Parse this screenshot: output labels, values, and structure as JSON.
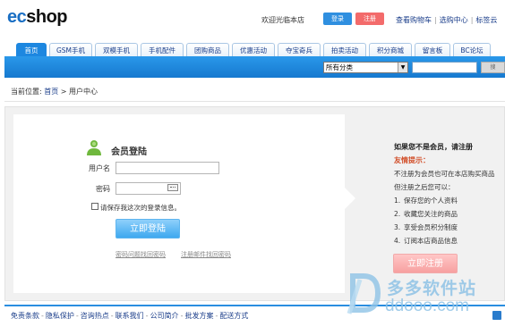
{
  "header": {
    "logo_part1": "ec",
    "logo_part2": "shop",
    "welcome": "欢迎光临本店",
    "login_label": "登录",
    "register_label": "注册",
    "top_links": [
      "查看购物车",
      "选购中心",
      "标签云"
    ]
  },
  "nav": {
    "tabs": [
      {
        "label": "首页",
        "active": true
      },
      {
        "label": "GSM手机"
      },
      {
        "label": "双模手机"
      },
      {
        "label": "手机配件"
      },
      {
        "label": "团购商品"
      },
      {
        "label": "优惠活动"
      },
      {
        "label": "夺宝奇兵"
      },
      {
        "label": "拍卖活动"
      },
      {
        "label": "积分商城"
      },
      {
        "label": "留言板"
      },
      {
        "label": "BC论坛"
      }
    ],
    "category_select": "所有分类",
    "search_button": "搜"
  },
  "breadcrumb": {
    "prefix": "当前位置:",
    "home": "首页",
    "sep": ">",
    "current": "用户中心"
  },
  "login": {
    "title": "会员登陆",
    "username_label": "用户名",
    "password_label": "密码",
    "username_value": "",
    "password_value": "",
    "remember_label": "请保存我这次的登录信息。",
    "submit_label": "立即登陆",
    "link_question": "密码问题找回密码",
    "link_email": "注册邮件找回密码"
  },
  "register_info": {
    "title": "如果您不是会员，请注册",
    "tip_title": "友情提示：",
    "line1": "不注册为会员也可在本店购买商品",
    "line2": "但注册之后您可以：",
    "items": [
      {
        "num": "1.",
        "text": "保存您的个人资料"
      },
      {
        "num": "2.",
        "text": "收藏您关注的商品"
      },
      {
        "num": "3.",
        "text": "享受会员积分制度"
      },
      {
        "num": "4.",
        "text": "订阅本店商品信息"
      }
    ],
    "register_button": "立即注册"
  },
  "footer": {
    "links": [
      "免责条款",
      "隐私保护",
      "咨询热点",
      "联系我们",
      "公司简介",
      "批发方案",
      "配送方式"
    ]
  },
  "watermark": {
    "cn": "多多软件站",
    "en": "ddooo.com"
  },
  "colors": {
    "nav_blue": "#1d87e0",
    "link_blue": "#1a3d8a",
    "tip_red": "#d24f2a",
    "register_pink": "#f7a0a0"
  }
}
